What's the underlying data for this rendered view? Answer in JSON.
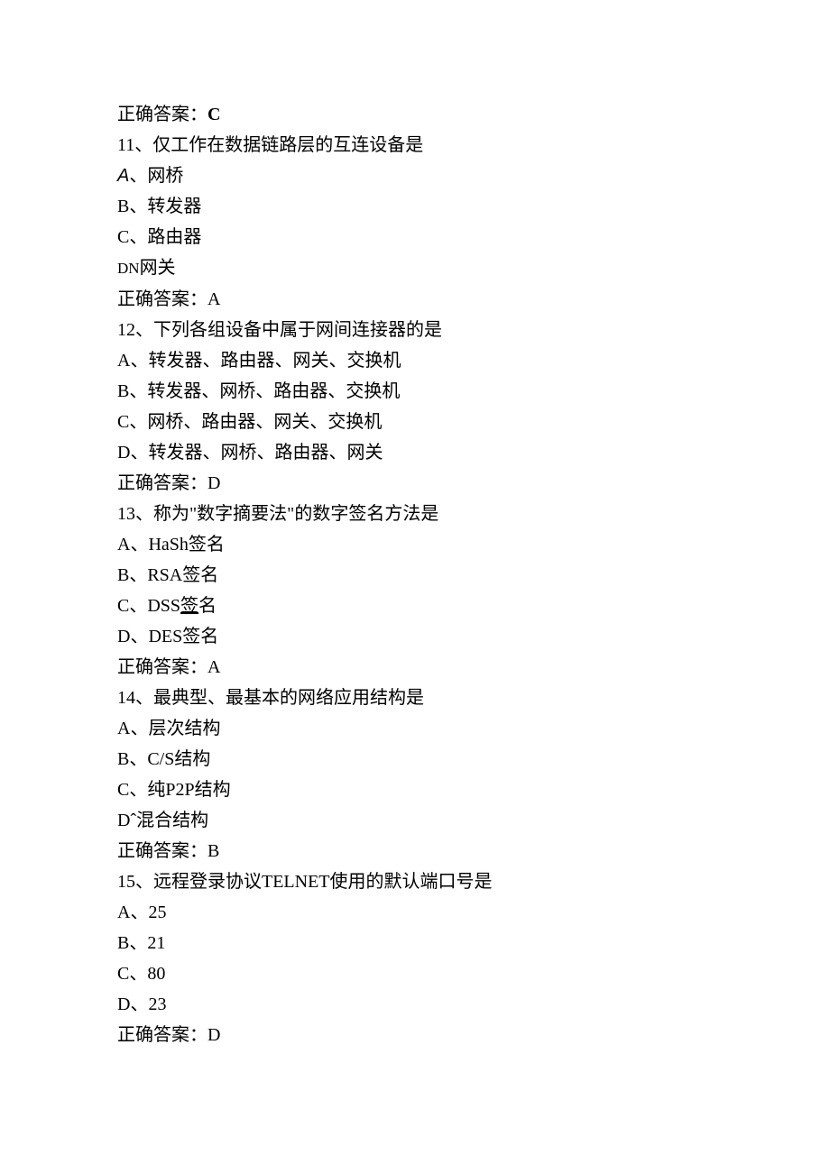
{
  "q10_answer_label": "正确答案：",
  "q10_answer_value": "C",
  "q11": {
    "stem": "11、仅工作在数据链路层的互连设备是",
    "a_prefix": "A",
    "a_text": "、网桥",
    "b": "B、转发器",
    "c": "C、路由器",
    "d_prefix": "D",
    "d_text": "网关",
    "answer": "正确答案：A"
  },
  "q12": {
    "stem": "12、下列各组设备中属于网间连接器的是",
    "a": "A、转发器、路由器、网关、交换机",
    "b": "B、转发器、网桥、路由器、交换机",
    "c": "C、网桥、路由器、网关、交换机",
    "d": "D、转发器、网桥、路由器、网关",
    "answer": "正确答案：D"
  },
  "q13": {
    "stem": "13、称为\"数字摘要法\"的数字签名方法是",
    "a": "A、HaSh签名",
    "b": "B、RSA签名",
    "c_pre": "C、DSS",
    "c_mid": "签",
    "c_suf": "名",
    "d": "D、DES签名",
    "answer": "正确答案：A"
  },
  "q14": {
    "stem": "14、最典型、最基本的网络应用结构是",
    "a": "A、层次结构",
    "b": "B、C/S结构",
    "c": "C、纯P2P结构",
    "d_prefix": "D",
    "d_caret": "ˆ",
    "d_text": "混合结构",
    "answer": "正确答案：B"
  },
  "q15": {
    "stem": "15、远程登录协议TELNET使用的默认端口号是",
    "a": "A、25",
    "b": "B、21",
    "c": "C、80",
    "d": "D、23",
    "answer": "正确答案：D"
  }
}
